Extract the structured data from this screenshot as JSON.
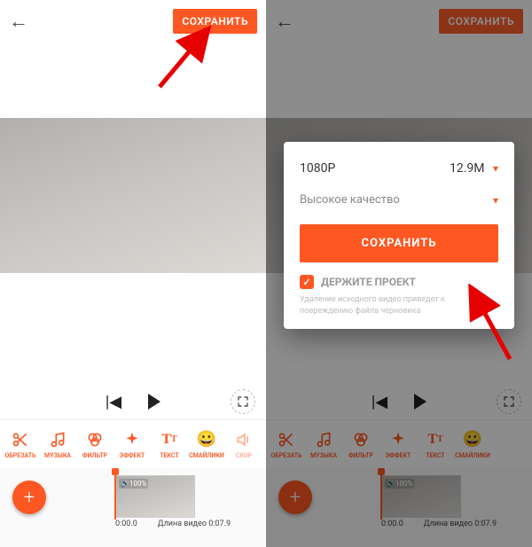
{
  "left": {
    "save_label": "СОХРАНИТЬ",
    "tools": [
      "ОБРЕЗАТЬ",
      "МУЗЫКА",
      "ФИЛЬТР",
      "ЭФФЕКТ",
      "ТЕКСТ",
      "СМАЙЛИКИ",
      "СКОР"
    ],
    "clip_volume": "100%",
    "time_start": "0:00.0",
    "duration_label": "Длина видео 0:07.9"
  },
  "right": {
    "save_label": "СОХРАНИТЬ",
    "dialog": {
      "resolution": "1080P",
      "filesize": "12.9M",
      "quality": "Высокое качество",
      "save_button": "СОХРАНИТЬ",
      "keep_project": "ДЕРЖИТЕ ПРОЕКТ",
      "note": "Удаление исходного видео приведет к повреждению файла черновика"
    },
    "tools": [
      "ОБРЕЗАТЬ",
      "МУЗЫКА",
      "ФИЛЬТР",
      "ЭФФЕКТ",
      "ТЕКСТ",
      "СМАЙЛИКИ"
    ],
    "clip_volume": "100%",
    "time_start": "0:00.0",
    "duration_label": "Длина видео 0:07.9"
  }
}
